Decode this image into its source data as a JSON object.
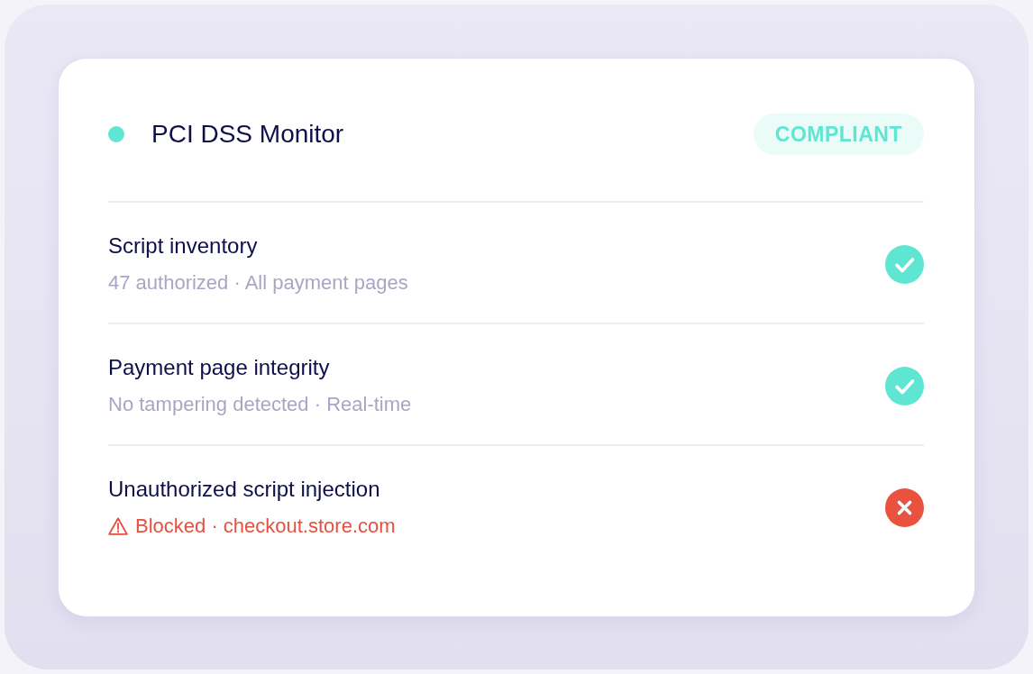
{
  "monitor": {
    "title": "PCI DSS Monitor",
    "active": true,
    "badge": "COMPLIANT"
  },
  "checks": [
    {
      "title": "Script inventory",
      "detail": "47 authorized · All payment pages",
      "passed": true
    },
    {
      "title": "Payment page integrity",
      "detail": "No tampering detected · Real-time",
      "passed": true
    },
    {
      "title": "Unauthorized script injection",
      "detail": "Blocked · checkout.store.com",
      "passed": false
    }
  ]
}
